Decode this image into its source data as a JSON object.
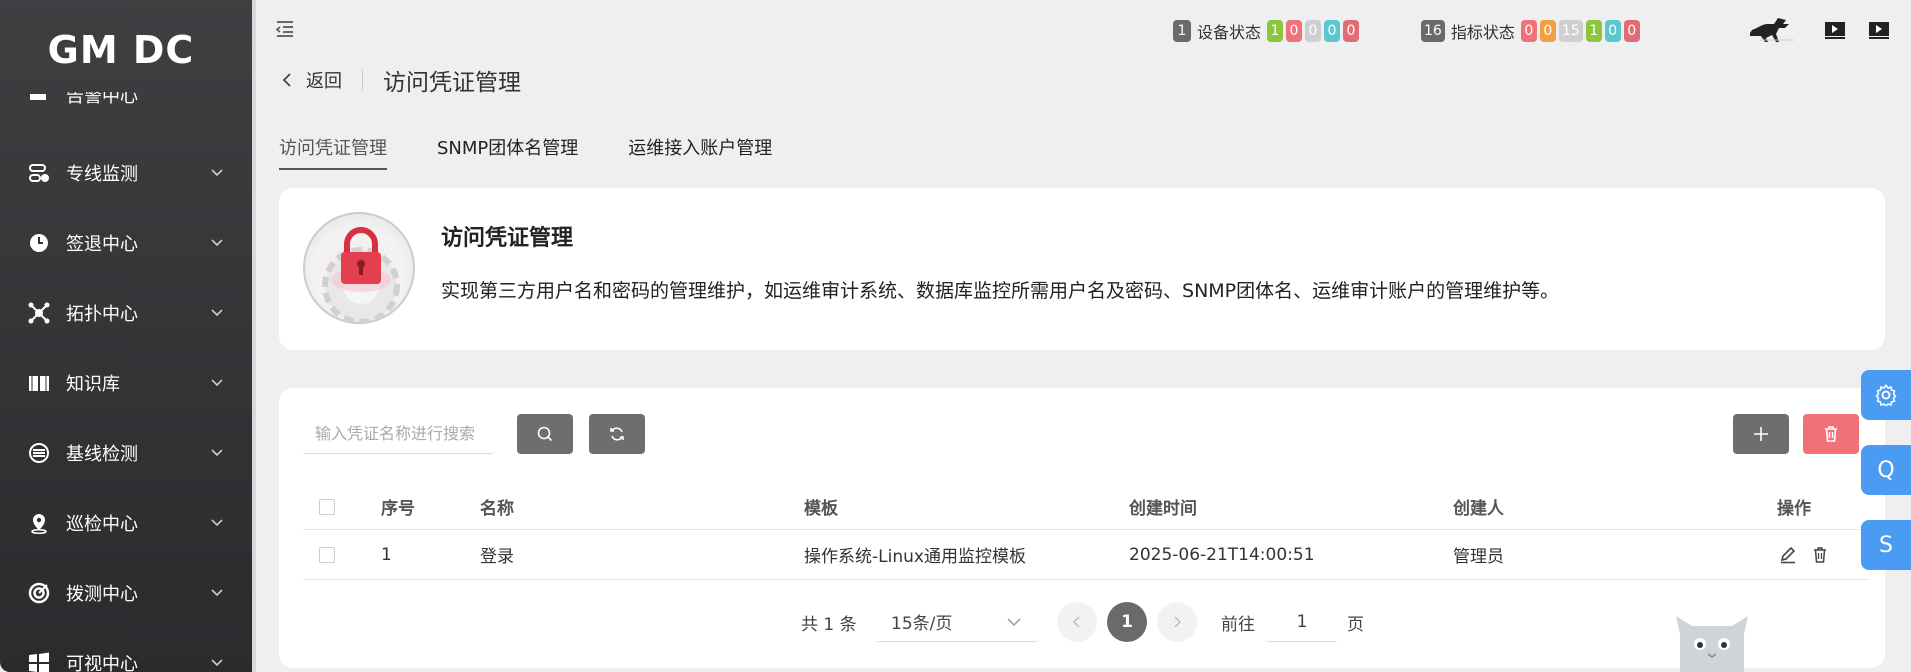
{
  "app": {
    "logo": "GM DC"
  },
  "sidebar": {
    "partial_label": "告警中心",
    "items": [
      {
        "label": "专线监测",
        "icon": "line-monitor-icon"
      },
      {
        "label": "签退中心",
        "icon": "clock-icon"
      },
      {
        "label": "拓扑中心",
        "icon": "topology-icon"
      },
      {
        "label": "知识库",
        "icon": "book-icon"
      },
      {
        "label": "基线检测",
        "icon": "baseline-icon"
      },
      {
        "label": "巡检中心",
        "icon": "location-icon"
      },
      {
        "label": "拨测中心",
        "icon": "dial-icon"
      },
      {
        "label": "可视中心",
        "icon": "windows-icon"
      }
    ]
  },
  "topbar": {
    "device": {
      "total": "1",
      "label": "设备状态",
      "counts": [
        "1",
        "0",
        "0",
        "0",
        "0"
      ]
    },
    "metric": {
      "total": "16",
      "label": "指标状态",
      "counts": [
        "0",
        "0",
        "15",
        "1",
        "0",
        "0"
      ]
    }
  },
  "header": {
    "back_label": "返回",
    "title": "访问凭证管理"
  },
  "tabs": [
    {
      "label": "访问凭证管理",
      "active": true
    },
    {
      "label": "SNMP团体名管理",
      "active": false
    },
    {
      "label": "运维接入账户管理",
      "active": false
    }
  ],
  "info": {
    "title": "访问凭证管理",
    "description": "实现第三方用户名和密码的管理维护，如运维审计系统、数据库监控所需用户名及密码、SNMP团体名、运维审计账户的管理维护等。"
  },
  "search": {
    "placeholder": "输入凭证名称进行搜索"
  },
  "table": {
    "columns": [
      "序号",
      "名称",
      "模板",
      "创建时间",
      "创建人",
      "操作"
    ],
    "rows": [
      {
        "index": "1",
        "name": "登录",
        "template": "操作系统-Linux通用监控模板",
        "created": "2025-06-21T14:00:51",
        "creator": "管理员"
      }
    ]
  },
  "pagination": {
    "total": "共 1 条",
    "page_size": "15条/页",
    "current": "1",
    "goto_label": "前往",
    "goto_value": "1",
    "page_unit": "页"
  },
  "floating": {
    "q_label": "Q",
    "s_label": "S"
  },
  "colors": {
    "green": "#8cc63f",
    "red": "#f07178",
    "gray": "#cfcfcf",
    "teal": "#5bc8d0",
    "orange": "#f0a040",
    "darkred": "#e06c75",
    "blue": "#4a9cf2"
  }
}
